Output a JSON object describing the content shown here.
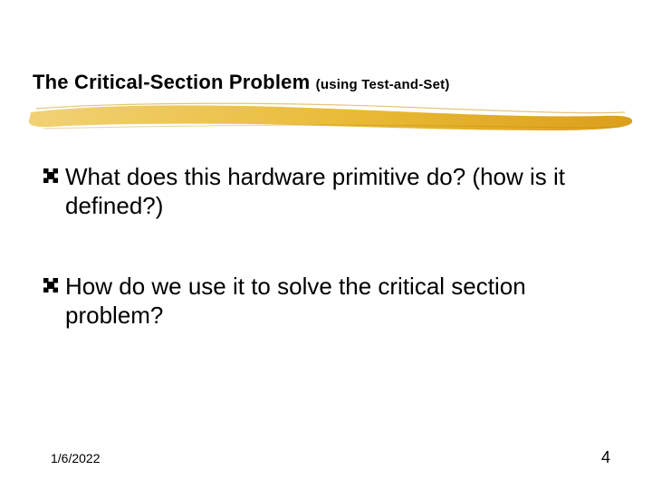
{
  "title": {
    "main": "The Critical-Section Problem ",
    "sub": "(using Test-and-Set)"
  },
  "bullets": [
    {
      "text": "What does this hardware primitive do? (how is it defined?)"
    },
    {
      "text": "How do we use it to solve the critical section problem?"
    }
  ],
  "footer": {
    "date": "1/6/2022",
    "page": "4"
  },
  "colors": {
    "golden_light": "#f6d77a",
    "golden": "#e6b327",
    "golden_dark": "#c98e0f"
  }
}
